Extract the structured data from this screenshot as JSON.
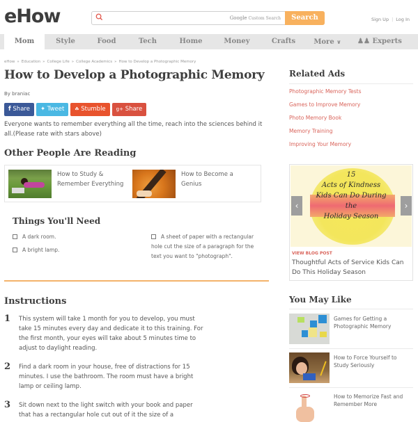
{
  "header": {
    "logo": "eHow",
    "search": {
      "placeholder": "",
      "powered_by_brand": "Google",
      "powered_by_text": "Custom Search",
      "button_label": "Search"
    },
    "sign_up": "Sign Up",
    "log_in": "Log In"
  },
  "nav": {
    "tabs": [
      {
        "label": "Mom",
        "active": true
      },
      {
        "label": "Style"
      },
      {
        "label": "Food"
      },
      {
        "label": "Tech"
      },
      {
        "label": "Home"
      },
      {
        "label": "Money"
      },
      {
        "label": "Crafts"
      },
      {
        "label": "More"
      },
      {
        "label": "Experts"
      }
    ]
  },
  "breadcrumb": [
    "eHow",
    "Education",
    "College Life",
    "College Academics",
    "How to Develop a Photographic Memory"
  ],
  "breadcrumb_sep": "»",
  "article": {
    "title": "How to Develop a Photographic Memory",
    "byline": "By braniac",
    "share_buttons": [
      {
        "icon": "f",
        "label": "Share",
        "color": "#3b5998"
      },
      {
        "icon": "twitter-bird",
        "label": "Tweet",
        "color": "#4ab8e3"
      },
      {
        "icon": "stumble",
        "label": "Stumble",
        "color": "#e8532d"
      },
      {
        "icon": "g+",
        "label": "Share",
        "color": "#d9513f"
      }
    ],
    "intro": "Everyone wants to remember everything all the time, reach into the sciences behind it all.(Please rate with stars above)",
    "other_reading_title": "Other People Are Reading",
    "other_reading": [
      {
        "title": "How to Study & Remember Everything"
      },
      {
        "title": "How to Become a Genius"
      }
    ],
    "things_title": "Things You'll Need",
    "things": [
      "A dark room.",
      "A bright lamp.",
      "A sheet of paper with a rectangular hole cut the size of a paragraph for the text you want to \"photograph\"."
    ],
    "instructions_title": "Instructions",
    "steps": [
      {
        "num": "1",
        "text": "This system will take 1 month for you to develop, you must take 15 minutes every day and dedicate it to this training. For the first month, your eyes will take about 5 minutes time to adjust to daylight reading."
      },
      {
        "num": "2",
        "text": "Find a dark room in your house, free of distractions for 15 minutes. I use the bathroom. The room must have a bright lamp or ceiling lamp."
      },
      {
        "num": "3",
        "text": "Sit down next to the light switch with your book and paper that has a rectangular hole cut out of it the size of a"
      }
    ]
  },
  "sidebar": {
    "related_ads_title": "Related Ads",
    "related_ads": [
      "Photographic Memory Tests",
      "Games to Improve Memory",
      "Photo Memory Book",
      "Memory Training",
      "Improving Your Memory"
    ],
    "blog": {
      "image_text": [
        "15",
        "Acts of Kindness",
        "Kids Can Do During",
        "the",
        "Holiday Season"
      ],
      "label": "VIEW BLOG POST",
      "title": "Thoughtful Acts of Service Kids Can Do This Holiday Season",
      "prev": "‹",
      "next": "›"
    },
    "you_may_like_title": "You May Like",
    "you_may_like": [
      {
        "title": "Games for Getting a Photographic Memory"
      },
      {
        "title": "How to Force Yourself to Study Seriously"
      },
      {
        "title": "How to Memorize Fast and Remember More"
      }
    ]
  }
}
